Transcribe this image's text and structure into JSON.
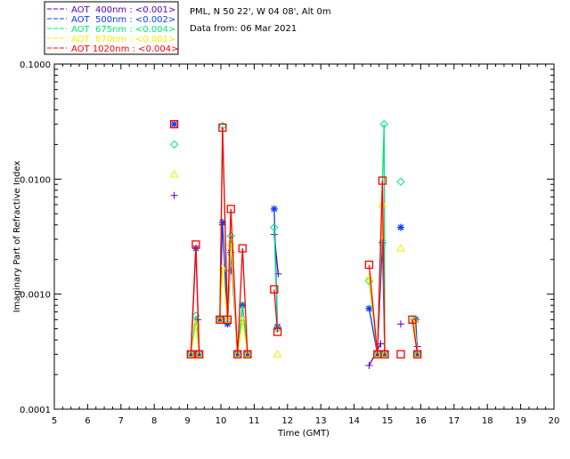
{
  "header": {
    "location": "PML, N 50 22', W 04 08', Alt 0m",
    "date": "Data from: 06 Mar 2021"
  },
  "chart_data": {
    "type": "line",
    "xlabel": "Time (GMT)",
    "ylabel": "Imaginary Part of Refractive Index",
    "xlim": [
      5,
      20
    ],
    "ylim": [
      0.0001,
      0.1
    ],
    "yscale": "log",
    "xticks": [
      "5",
      "6",
      "7",
      "8",
      "9",
      "10",
      "11",
      "12",
      "13",
      "14",
      "15",
      "16",
      "17",
      "18",
      "19",
      "20"
    ],
    "yticks": [
      "0.0001",
      "0.0010",
      "0.0100",
      "0.1000"
    ],
    "legend_position": "top-left, outside",
    "series": [
      {
        "name": "AOT  400nm : <0.001>",
        "color": "#5a00b4",
        "marker": "plus",
        "segments": [
          [
            [
              8.6,
              0.0072
            ]
          ],
          [
            [
              9.3,
              0.0006
            ]
          ],
          [
            [
              10.05,
              0.004
            ]
          ],
          [
            [
              10.3,
              0.0016
            ]
          ],
          [
            [
              11.6,
              0.0033
            ],
            [
              11.72,
              0.0015
            ]
          ],
          [
            [
              14.45,
              0.00024
            ],
            [
              14.8,
              0.00037
            ]
          ],
          [
            [
              15.4,
              0.00055
            ]
          ],
          [
            [
              15.9,
              0.00035
            ]
          ]
        ]
      },
      {
        "name": "AOT  500nm : <0.002>",
        "color": "#0a3cff",
        "marker": "asterisk",
        "segments": [
          [
            [
              8.6,
              0.03
            ]
          ],
          [
            [
              9.1,
              0.0003
            ],
            [
              9.25,
              0.0025
            ],
            [
              9.35,
              0.0003
            ]
          ],
          [
            [
              9.97,
              0.0006
            ],
            [
              10.05,
              0.0042
            ],
            [
              10.2,
              0.00055
            ],
            [
              10.3,
              0.0023
            ],
            [
              10.5,
              0.0003
            ],
            [
              10.65,
              0.0008
            ],
            [
              10.8,
              0.0003
            ]
          ],
          [
            [
              11.6,
              0.0055
            ],
            [
              11.7,
              0.00052
            ]
          ],
          [
            [
              14.45,
              0.00075
            ],
            [
              14.7,
              0.0003
            ],
            [
              14.85,
              0.0028
            ],
            [
              14.92,
              0.0003
            ]
          ],
          [
            [
              15.4,
              0.0038
            ]
          ],
          [
            [
              15.85,
              0.0006
            ],
            [
              15.9,
              0.0003
            ]
          ]
        ]
      },
      {
        "name": "AOT  675nm : <0.004>",
        "color": "#00e67a",
        "marker": "diamond",
        "segments": [
          [
            [
              8.6,
              0.02
            ]
          ],
          [
            [
              9.1,
              0.0003
            ],
            [
              9.25,
              0.00065
            ],
            [
              9.35,
              0.0003
            ]
          ],
          [
            [
              9.97,
              0.0006
            ],
            [
              10.05,
              0.029
            ],
            [
              10.2,
              0.0006
            ],
            [
              10.3,
              0.0032
            ],
            [
              10.5,
              0.0003
            ],
            [
              10.65,
              0.0008
            ],
            [
              10.8,
              0.0003
            ]
          ],
          [
            [
              11.6,
              0.0038
            ],
            [
              11.7,
              0.0005
            ]
          ],
          [
            [
              14.45,
              0.0013
            ],
            [
              14.7,
              0.0003
            ],
            [
              14.9,
              0.03
            ],
            [
              14.92,
              0.0003
            ]
          ],
          [
            [
              15.4,
              0.0095
            ]
          ],
          [
            [
              15.8,
              0.0006
            ],
            [
              15.9,
              0.0003
            ]
          ]
        ]
      },
      {
        "name": "AOT  870nm : <0.001>",
        "color": "#f0f000",
        "marker": "triangle",
        "segments": [
          [
            [
              8.6,
              0.011
            ]
          ],
          [
            [
              9.1,
              0.0003
            ],
            [
              9.25,
              0.00055
            ],
            [
              9.35,
              0.0003
            ]
          ],
          [
            [
              9.97,
              0.0006
            ],
            [
              10.05,
              0.0017
            ],
            [
              10.2,
              0.0006
            ],
            [
              10.3,
              0.0028
            ],
            [
              10.5,
              0.0003
            ],
            [
              10.65,
              0.0006
            ],
            [
              10.8,
              0.0003
            ]
          ],
          [
            [
              11.7,
              0.0003
            ]
          ],
          [
            [
              14.45,
              0.0014
            ],
            [
              14.7,
              0.0003
            ],
            [
              14.85,
              0.006
            ],
            [
              14.92,
              0.0003
            ]
          ],
          [
            [
              15.4,
              0.0025
            ]
          ],
          [
            [
              15.8,
              0.0006
            ],
            [
              15.9,
              0.0003
            ]
          ]
        ]
      },
      {
        "name": "AOT 1020nm : <0.004>",
        "color": "#ff0000",
        "marker": "square",
        "segments": [
          [
            [
              8.6,
              0.03
            ]
          ],
          [
            [
              9.1,
              0.0003
            ],
            [
              9.25,
              0.0027
            ],
            [
              9.35,
              0.0003
            ]
          ],
          [
            [
              9.97,
              0.0006
            ],
            [
              10.05,
              0.028
            ],
            [
              10.2,
              0.0006
            ],
            [
              10.3,
              0.0055
            ],
            [
              10.5,
              0.0003
            ],
            [
              10.65,
              0.0025
            ],
            [
              10.8,
              0.0003
            ]
          ],
          [
            [
              11.6,
              0.0011
            ],
            [
              11.7,
              0.00047
            ]
          ],
          [
            [
              14.45,
              0.0018
            ],
            [
              14.7,
              0.0003
            ],
            [
              14.85,
              0.0097
            ],
            [
              14.92,
              0.0003
            ]
          ],
          [
            [
              15.4,
              0.0003
            ]
          ],
          [
            [
              15.75,
              0.0006
            ],
            [
              15.9,
              0.0003
            ]
          ]
        ]
      }
    ]
  }
}
